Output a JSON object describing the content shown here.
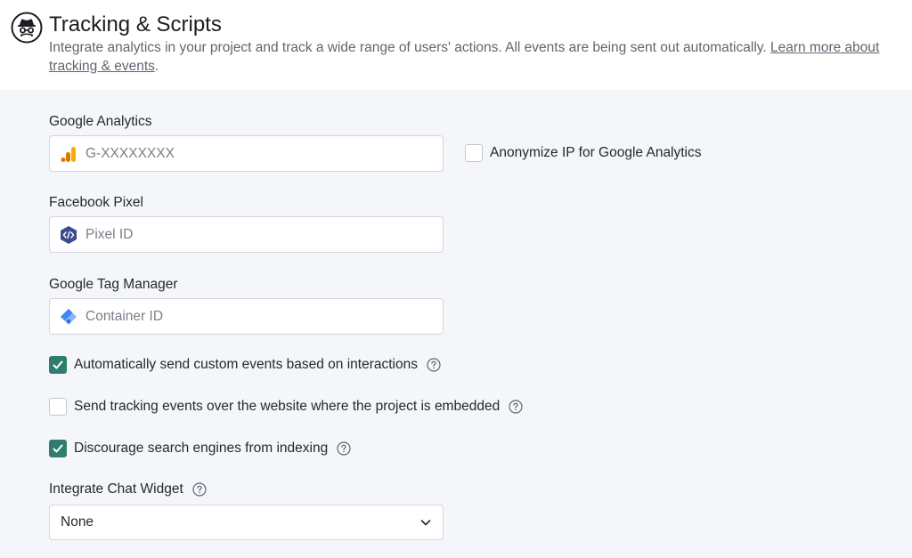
{
  "header": {
    "title": "Tracking & Scripts",
    "description": "Integrate analytics in your project and track a wide range of users' actions. All events are being sent out automatically.",
    "learn_link": "Learn more about tracking & events",
    "icon": "incognito-icon"
  },
  "google_analytics": {
    "label": "Google Analytics",
    "placeholder": "G-XXXXXXXX",
    "value": "",
    "icon": "google-analytics-icon",
    "anonymize_label": "Anonymize IP for Google Analytics",
    "anonymize_checked": false
  },
  "facebook_pixel": {
    "label": "Facebook Pixel",
    "placeholder": "Pixel ID",
    "value": "",
    "icon": "code-icon"
  },
  "google_tag_manager": {
    "label": "Google Tag Manager",
    "placeholder": "Container ID",
    "value": "",
    "icon": "tag-manager-icon"
  },
  "options": [
    {
      "label": "Automatically send custom events based on interactions",
      "checked": true
    },
    {
      "label": "Send tracking events over the website where the project is embedded",
      "checked": false
    },
    {
      "label": "Discourage search engines from indexing",
      "checked": true
    }
  ],
  "chat_widget": {
    "label": "Integrate Chat Widget",
    "selected": "None"
  },
  "colors": {
    "accent": "#2f7d6f",
    "panel_bg": "#f4f6fa",
    "ga_orange": "#f9ab00",
    "ga_dark": "#e37400",
    "pixel_blue": "#3b4a8f",
    "gtm_blue": "#8ab4f8"
  }
}
